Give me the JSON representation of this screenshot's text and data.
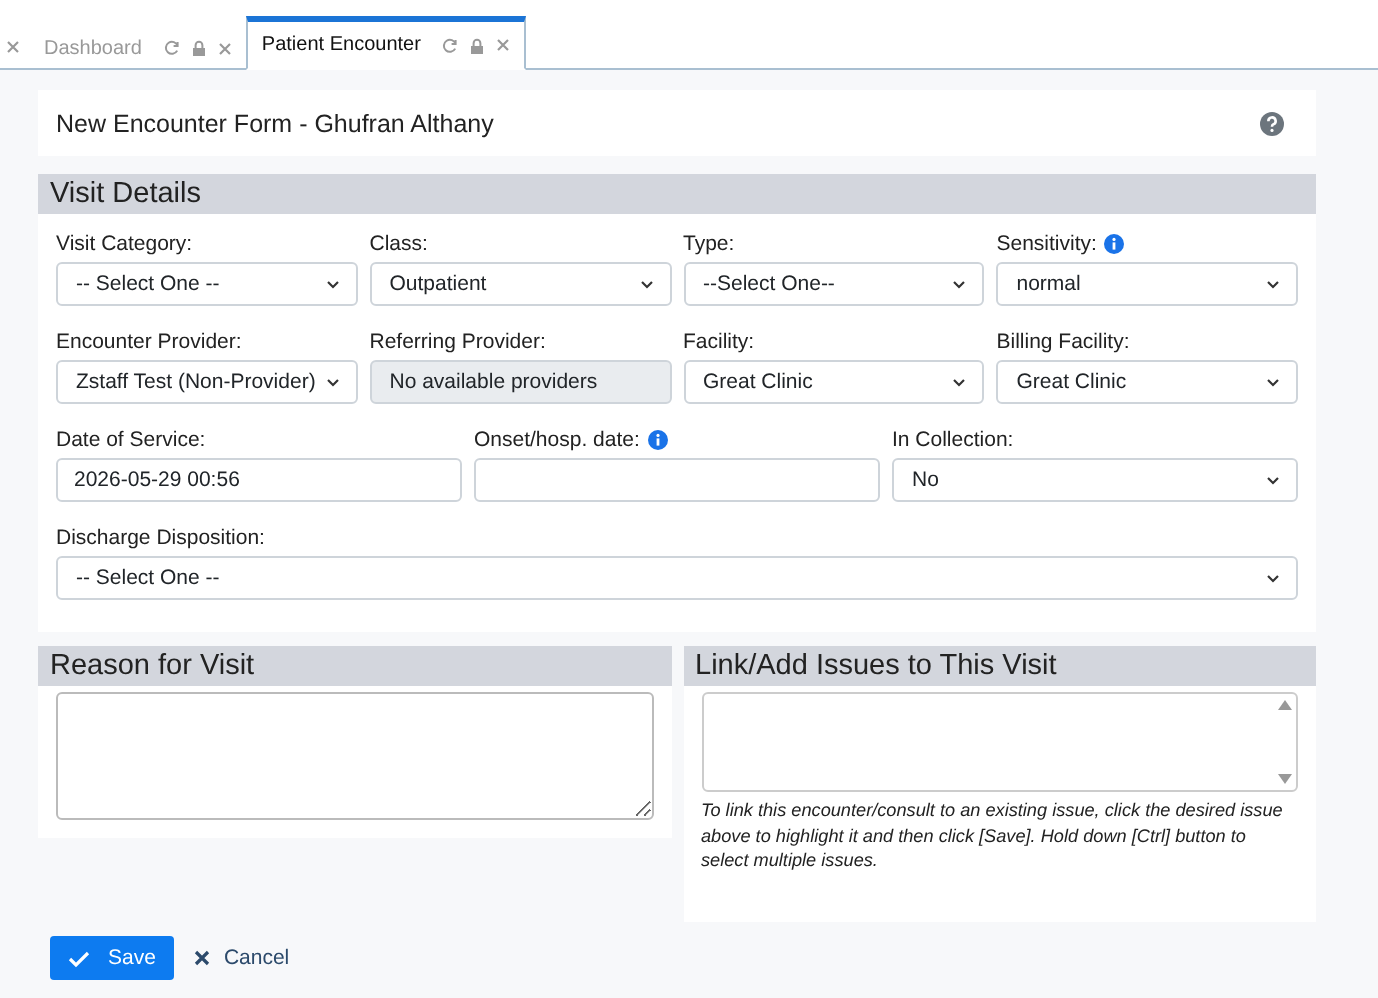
{
  "tabs": {
    "cut_tab_before": true,
    "items": [
      {
        "label": "Dashboard",
        "selected": false
      },
      {
        "label": "Patient Encounter",
        "selected": true
      }
    ]
  },
  "header": {
    "title": "New Encounter Form - Ghufran Althany",
    "help": true
  },
  "visit_details": {
    "title": "Visit Details",
    "rows": [
      [
        {
          "label": "Visit Category:",
          "kind": "select",
          "value": "-- Select One --"
        },
        {
          "label": "Class:",
          "kind": "select",
          "value": "Outpatient"
        },
        {
          "label": "Type:",
          "kind": "select",
          "value": "--Select One--"
        },
        {
          "label": "Sensitivity:",
          "kind": "select",
          "value": "normal",
          "info": true
        }
      ],
      [
        {
          "label": "Encounter Provider:",
          "kind": "select",
          "value": "Zstaff Test (Non-Provider)"
        },
        {
          "label": "Referring Provider:",
          "kind": "readonly",
          "value": "No available providers"
        },
        {
          "label": "Facility:",
          "kind": "select",
          "value": "Great Clinic"
        },
        {
          "label": "Billing Facility:",
          "kind": "select",
          "value": "Great Clinic"
        }
      ],
      [
        {
          "label": "Date of Service:",
          "kind": "input",
          "value": "2026-05-29 00:56"
        },
        {
          "label": "Onset/hosp. date:",
          "kind": "input",
          "info": true
        },
        {
          "label": "In Collection:",
          "kind": "select",
          "value": "No"
        }
      ],
      [
        {
          "label": "Discharge Disposition:",
          "kind": "select",
          "value": "-- Select One --"
        }
      ]
    ]
  },
  "reason": {
    "title": "Reason for Visit"
  },
  "issues": {
    "title": "Link/Add Issues to This Visit",
    "help_text": "To link this encounter/consult to an existing issue, click the desired issue above to highlight it and then click [Save]. Hold down [Ctrl] button to select multiple issues."
  },
  "buttons": [
    {
      "kind": "primary",
      "label": "Save"
    },
    {
      "kind": "link",
      "label": "Cancel"
    }
  ]
}
